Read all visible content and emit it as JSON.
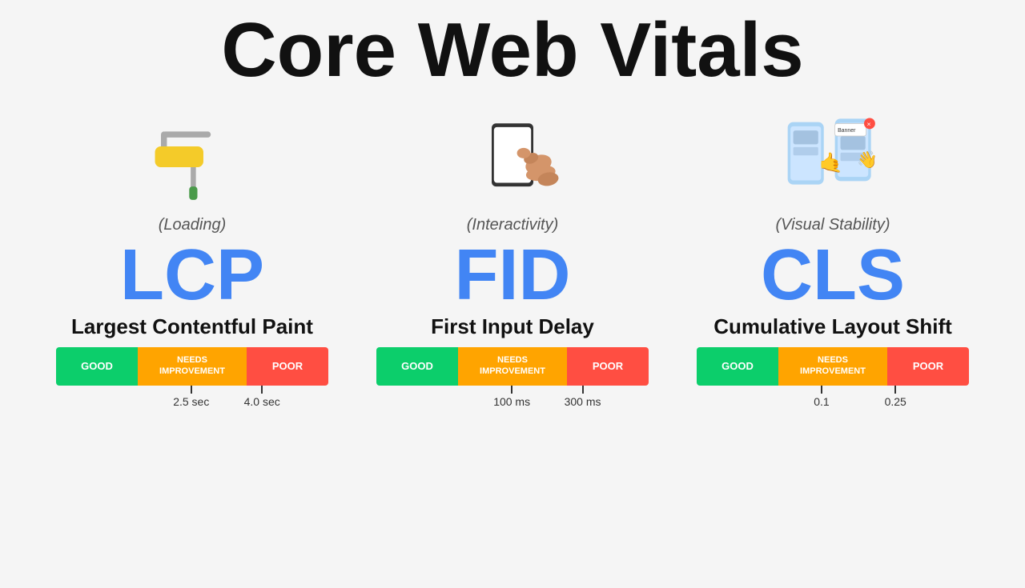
{
  "page": {
    "title": "Core Web Vitals",
    "background": "#f5f5f5"
  },
  "metrics": [
    {
      "id": "lcp",
      "subtitle": "(Loading)",
      "acronym": "LCP",
      "name": "Largest Contentful Paint",
      "scale": {
        "good": "GOOD",
        "needs": "NEEDS\nIMPROVEMENT",
        "poor": "POOR",
        "marker1_label": "2.5 sec",
        "marker2_label": "4.0 sec"
      }
    },
    {
      "id": "fid",
      "subtitle": "(Interactivity)",
      "acronym": "FID",
      "name": "First Input Delay",
      "scale": {
        "good": "GOOD",
        "needs": "NEEDS\nIMPROVEMENT",
        "poor": "POOR",
        "marker1_label": "100 ms",
        "marker2_label": "300 ms"
      }
    },
    {
      "id": "cls",
      "subtitle": "(Visual Stability)",
      "acronym": "CLS",
      "name": "Cumulative Layout Shift",
      "scale": {
        "good": "GOOD",
        "needs": "NEEDS\nIMPROVEMENT",
        "poor": "POOR",
        "marker1_label": "0.1",
        "marker2_label": "0.25"
      }
    }
  ],
  "colors": {
    "good": "#0cce6b",
    "needs": "#ffa400",
    "poor": "#ff4e42",
    "acronym": "#4285f4",
    "title": "#111111"
  }
}
